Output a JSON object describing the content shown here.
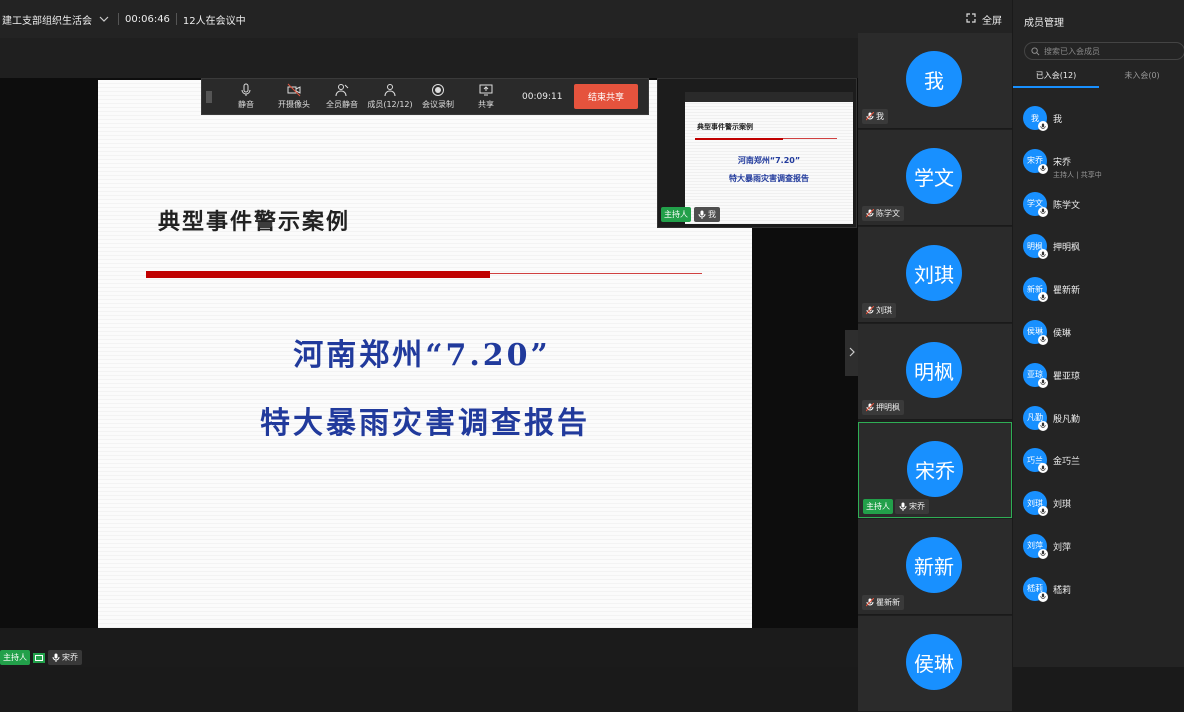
{
  "topbar": {
    "meeting_title": "建工支部组织生活会",
    "elapsed": "00:06:46",
    "participants_status": "12人在会议中",
    "fullscreen_label": "全屏"
  },
  "toolbar": {
    "mute_label": "静音",
    "camera_label": "开摄像头",
    "mute_all_label": "全员静音",
    "members_label": "成员(12/12)",
    "record_label": "会议录制",
    "share_label": "共享",
    "share_time": "00:09:11",
    "end_share_label": "结束共享"
  },
  "slide": {
    "title": "典型事件警示案例",
    "headline1": "河南郑州“7.20”",
    "headline2": "特大暴雨灾害调查报告"
  },
  "preview": {
    "host_badge": "主持人",
    "name": "我"
  },
  "video_tiles": [
    {
      "avatar": "我",
      "name": "我",
      "host": ""
    },
    {
      "avatar": "学文",
      "name": "陈学文",
      "host": ""
    },
    {
      "avatar": "刘琪",
      "name": "刘琪",
      "host": ""
    },
    {
      "avatar": "明枫",
      "name": "押明枫",
      "host": ""
    },
    {
      "avatar": "宋乔",
      "name": "宋乔",
      "host": "主持人"
    },
    {
      "avatar": "新新",
      "name": "瞿新新",
      "host": ""
    },
    {
      "avatar": "侯琳",
      "name": "",
      "host": ""
    }
  ],
  "bottom": {
    "host_badge": "主持人",
    "name": "宋乔"
  },
  "members": {
    "title": "成员管理",
    "search_placeholder": "搜索已入会成员",
    "tab_joined": "已入会(12)",
    "tab_not_joined": "未入会(0)",
    "list": [
      {
        "avatar": "我",
        "name": "我",
        "sub": ""
      },
      {
        "avatar": "宋乔",
        "name": "宋乔",
        "sub": "主持人 | 共享中"
      },
      {
        "avatar": "学文",
        "name": "陈学文",
        "sub": ""
      },
      {
        "avatar": "明枫",
        "name": "押明枫",
        "sub": ""
      },
      {
        "avatar": "新新",
        "name": "瞿新新",
        "sub": ""
      },
      {
        "avatar": "侯琳",
        "name": "侯琳",
        "sub": ""
      },
      {
        "avatar": "亚琼",
        "name": "瞿亚琼",
        "sub": ""
      },
      {
        "avatar": "凡勤",
        "name": "殷凡勤",
        "sub": ""
      },
      {
        "avatar": "巧兰",
        "name": "金巧兰",
        "sub": ""
      },
      {
        "avatar": "刘琪",
        "name": "刘琪",
        "sub": ""
      },
      {
        "avatar": "刘萍",
        "name": "刘萍",
        "sub": ""
      },
      {
        "avatar": "嵇莉",
        "name": "嵇莉",
        "sub": ""
      }
    ]
  },
  "colors": {
    "accent": "#1890ff",
    "host_green": "#22a04a",
    "end_red": "#e5533d",
    "slide_blue": "#213a9c",
    "slide_red": "#c00000"
  }
}
